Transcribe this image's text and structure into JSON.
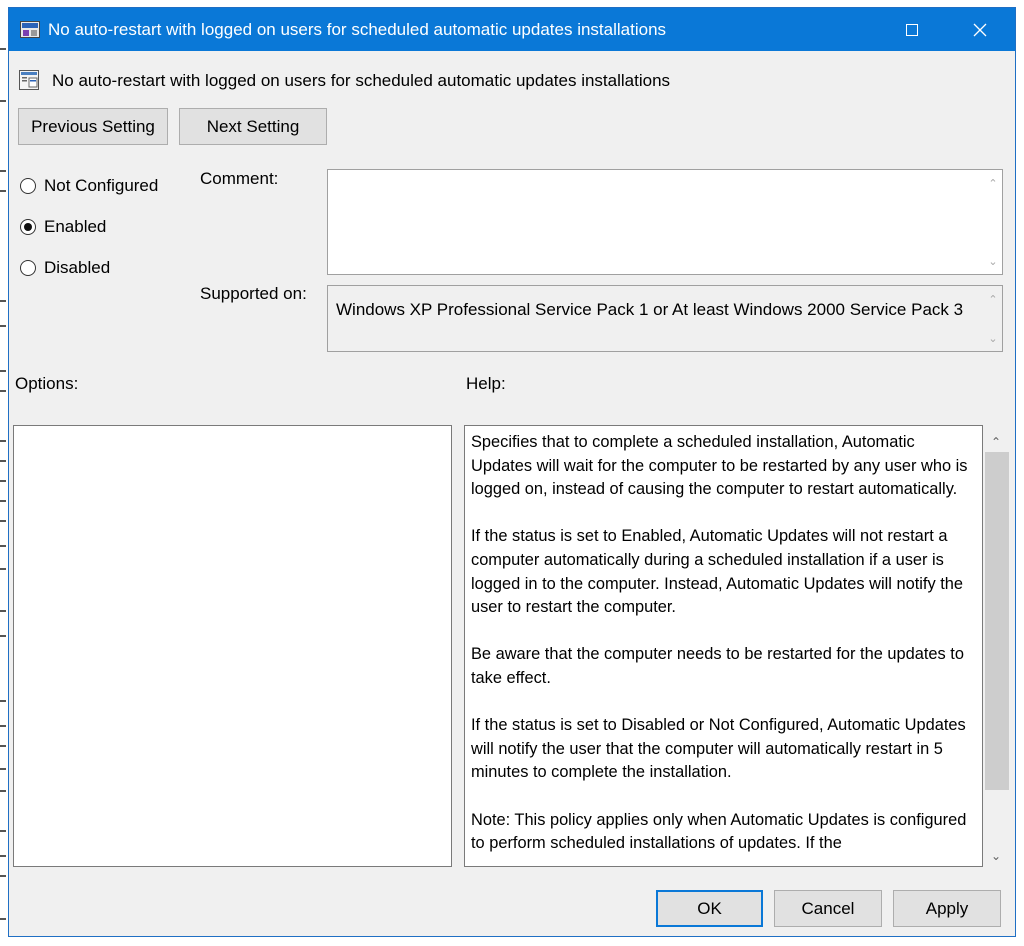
{
  "window": {
    "title": "No auto-restart with logged on users for scheduled automatic updates installations",
    "close_glyph": "✕",
    "maximize_glyph": "☐"
  },
  "policy": {
    "name": "No auto-restart with logged on users for scheduled automatic updates installations",
    "icon": "policy-setting-icon"
  },
  "nav": {
    "previous_label": "Previous Setting",
    "next_label": "Next Setting"
  },
  "state": {
    "options": [
      {
        "label": "Not Configured",
        "selected": false
      },
      {
        "label": "Enabled",
        "selected": true
      },
      {
        "label": "Disabled",
        "selected": false
      }
    ]
  },
  "comment": {
    "label": "Comment:",
    "value": ""
  },
  "supported": {
    "label": "Supported on:",
    "value": "Windows XP Professional Service Pack 1 or At least Windows 2000 Service Pack 3"
  },
  "options_panel": {
    "label": "Options:"
  },
  "help_panel": {
    "label": "Help:",
    "paragraphs": [
      "Specifies that to complete a scheduled installation, Automatic Updates will wait for the computer to be restarted by any user who is logged on, instead of causing the computer to restart automatically.",
      "If the status is set to Enabled, Automatic Updates will not restart a computer automatically during a scheduled installation if a user is logged in to the computer. Instead, Automatic Updates will notify the user to restart the computer.",
      "Be aware that the computer needs to be restarted for the updates to take effect.",
      "If the status is set to Disabled or Not Configured, Automatic Updates will notify the user that the computer will automatically restart in 5 minutes to complete the installation.",
      "Note: This policy applies only when Automatic Updates is configured to perform scheduled installations of updates. If the"
    ]
  },
  "footer": {
    "ok_label": "OK",
    "cancel_label": "Cancel",
    "apply_label": "Apply"
  },
  "colors": {
    "titlebar": "#0a78d7",
    "accent": "#0a78d7",
    "dialog_bg": "#f0f0f0"
  }
}
